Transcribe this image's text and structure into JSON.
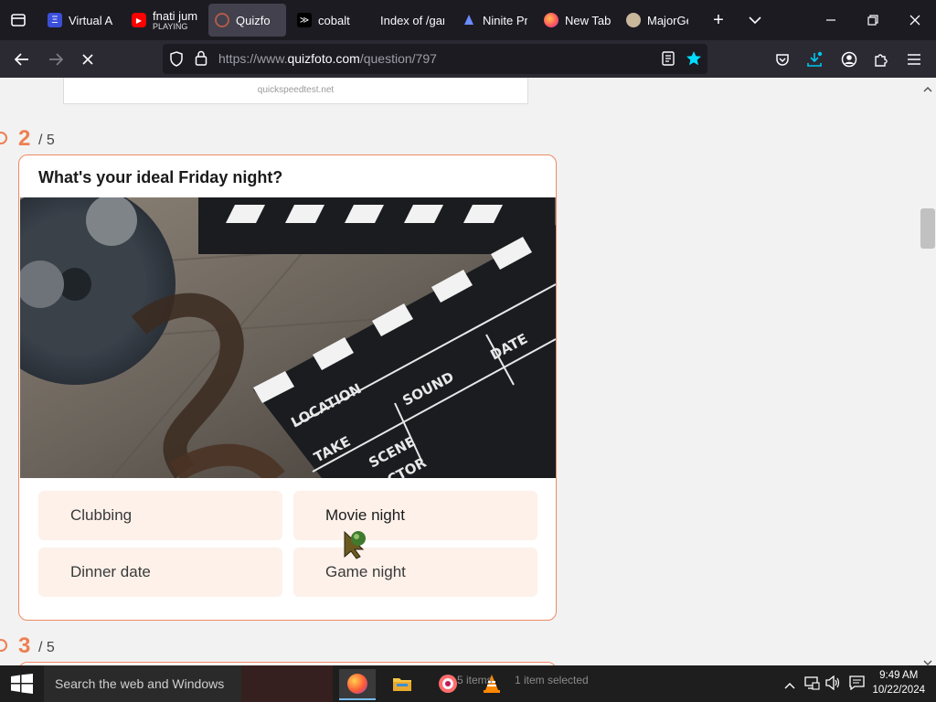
{
  "tabs": [
    {
      "label": "Virtual A",
      "icon": "virtual-icon"
    },
    {
      "label": "fnati jum",
      "sub": "PLAYING",
      "icon": "youtube-icon"
    },
    {
      "label": "Quizfo",
      "icon": "quizfoto-icon",
      "active": true
    },
    {
      "label": "cobalt",
      "icon": "cobalt-icon"
    },
    {
      "label": "Index of /gar",
      "icon": "none"
    },
    {
      "label": "Ninite Pr",
      "icon": "ninite-icon"
    },
    {
      "label": "New Tab",
      "icon": "firefox-icon"
    },
    {
      "label": "MajorGe",
      "icon": "majorgeeks-icon"
    }
  ],
  "url": {
    "prefix": "https://www.",
    "domain": "quizfoto.com",
    "path": "/question/797"
  },
  "ad": {
    "text": "quickspeedtest.net"
  },
  "question": {
    "number": "2",
    "total": "/ 5",
    "title": "What's your ideal Friday night?",
    "clapper_labels": {
      "location": "LOCATION",
      "sound": "SOUND",
      "date": "DATE",
      "take": "TAKE",
      "scene": "SCENE",
      "actor": "ACTOR"
    },
    "answers": [
      "Clubbing",
      "Movie night",
      "Dinner date",
      "Game night"
    ]
  },
  "next_question": {
    "number": "3",
    "total": "/ 5"
  },
  "taskbar": {
    "search_placeholder": "Search the web and Windows",
    "time": "9:49 AM",
    "date": "10/22/2024",
    "behind_text_1": "5 items",
    "behind_text_2": "1 item selected"
  },
  "colors": {
    "accent": "#ee7f52",
    "answer_bg": "#fdf1ea",
    "tabbar": "#1c1b22",
    "navbar": "#2b2a33"
  }
}
